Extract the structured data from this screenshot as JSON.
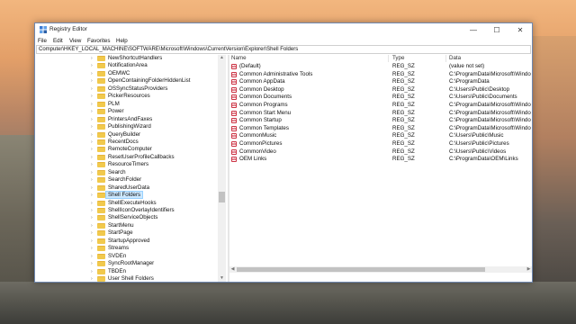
{
  "window": {
    "title": "Registry Editor",
    "controls": {
      "minimize": "—",
      "maximize": "☐",
      "close": "✕"
    }
  },
  "menu": [
    "File",
    "Edit",
    "View",
    "Favorites",
    "Help"
  ],
  "address": "Computer\\HKEY_LOCAL_MACHINE\\SOFTWARE\\Microsoft\\Windows\\CurrentVersion\\Explorer\\Shell Folders",
  "tree": {
    "selected": "Shell Folders",
    "items": [
      "NewShortcutHandlers",
      "NotificationArea",
      "OEMWC",
      "OpenContainingFolderHiddenList",
      "OSSyncStatusProviders",
      "PickerResources",
      "PLM",
      "Power",
      "PrintersAndFaxes",
      "PublishingWizard",
      "QueryBuilder",
      "RecentDocs",
      "RemoteComputer",
      "ResetUserProfileCallbacks",
      "ResourceTimers",
      "Search",
      "SearchFolder",
      "SharedUserData",
      "Shell Folders",
      "ShellExecuteHooks",
      "ShellIconOverlayIdentifiers",
      "ShellServiceObjects",
      "StartMenu",
      "StartPage",
      "StartupApproved",
      "Streams",
      "SVDEn",
      "SyncRootManager",
      "TBDEn",
      "User Shell Folders"
    ]
  },
  "columns": {
    "name": "Name",
    "type": "Type",
    "data": "Data"
  },
  "values": [
    {
      "name": "(Default)",
      "type": "REG_SZ",
      "data": "(value not set)"
    },
    {
      "name": "Common Administrative Tools",
      "type": "REG_SZ",
      "data": "C:\\ProgramData\\Microsoft\\Windo"
    },
    {
      "name": "Common AppData",
      "type": "REG_SZ",
      "data": "C:\\ProgramData"
    },
    {
      "name": "Common Desktop",
      "type": "REG_SZ",
      "data": "C:\\Users\\Public\\Desktop"
    },
    {
      "name": "Common Documents",
      "type": "REG_SZ",
      "data": "C:\\Users\\Public\\Documents"
    },
    {
      "name": "Common Programs",
      "type": "REG_SZ",
      "data": "C:\\ProgramData\\Microsoft\\Windo"
    },
    {
      "name": "Common Start Menu",
      "type": "REG_SZ",
      "data": "C:\\ProgramData\\Microsoft\\Windo"
    },
    {
      "name": "Common Startup",
      "type": "REG_SZ",
      "data": "C:\\ProgramData\\Microsoft\\Windo"
    },
    {
      "name": "Common Templates",
      "type": "REG_SZ",
      "data": "C:\\ProgramData\\Microsoft\\Windo"
    },
    {
      "name": "CommonMusic",
      "type": "REG_SZ",
      "data": "C:\\Users\\Public\\Music"
    },
    {
      "name": "CommonPictures",
      "type": "REG_SZ",
      "data": "C:\\Users\\Public\\Pictures"
    },
    {
      "name": "CommonVideo",
      "type": "REG_SZ",
      "data": "C:\\Users\\Public\\Videos"
    },
    {
      "name": "OEM Links",
      "type": "REG_SZ",
      "data": "C:\\ProgramData\\OEM\\Links"
    }
  ],
  "colors": {
    "folder": "#f1c94d",
    "selection": "#cce8ff",
    "string_icon": "#cc3344"
  },
  "icons": {
    "app": "registry-icon",
    "folder": "folder-icon",
    "value": "string-value-icon",
    "chevron": "chevron-right-icon"
  }
}
